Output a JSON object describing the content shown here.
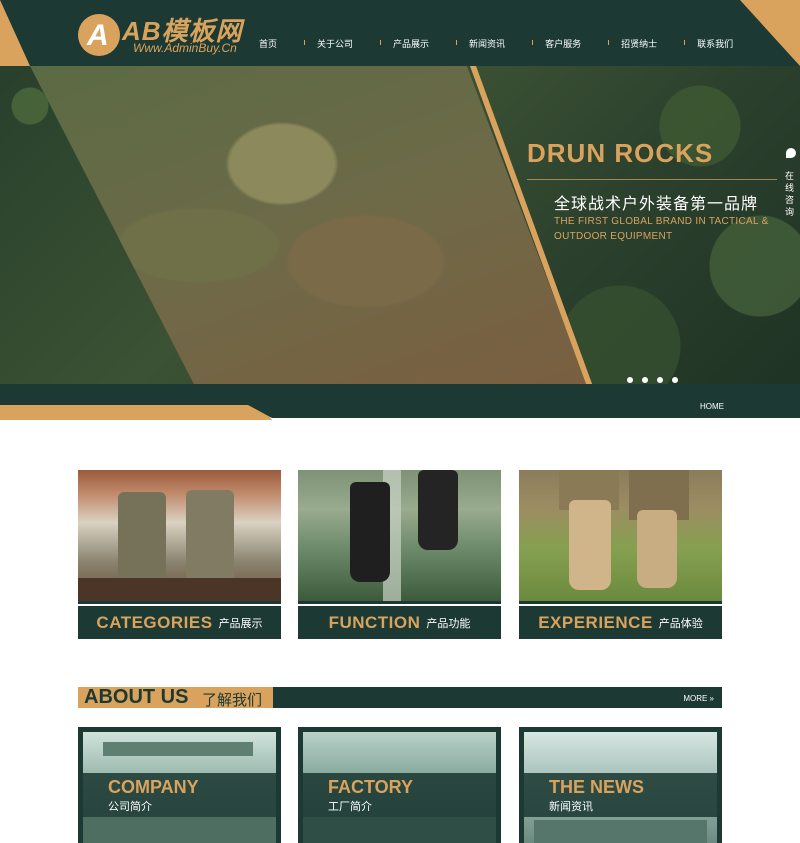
{
  "header": {
    "logo_mark": "A",
    "logo_title": "AB模板网",
    "logo_sub": "Www.AdminBuy.Cn",
    "nav": [
      "首页",
      "关于公司",
      "产品展示",
      "新闻资讯",
      "客户服务",
      "招贤纳士",
      "联系我们"
    ]
  },
  "banner": {
    "title": "DRUN ROCKS",
    "subtitle_cn": "全球战术户外装备第一品牌",
    "subtitle_en": "THE FIRST GLOBAL BRAND IN TACTICAL & OUTDOOR EQUIPMENT",
    "slides": 4,
    "side_consult": "在线咨询"
  },
  "breadcrumb": {
    "home": "HOME"
  },
  "products": [
    {
      "en": "CATEGORIES",
      "cn": "产品展示"
    },
    {
      "en": "FUNCTION",
      "cn": "产品功能"
    },
    {
      "en": "EXPERIENCE",
      "cn": "产品体验"
    }
  ],
  "about": {
    "title_en": "ABOUT US",
    "title_cn": "了解我们",
    "more": "MORE »",
    "cards": [
      {
        "en": "COMPANY",
        "cn": "公司简介"
      },
      {
        "en": "FACTORY",
        "cn": "工厂简介"
      },
      {
        "en": "THE NEWS",
        "cn": "新闻资讯"
      }
    ]
  },
  "colors": {
    "primary": "#1c3a33",
    "accent": "#d9a35e",
    "text_light": "#ffffff"
  }
}
